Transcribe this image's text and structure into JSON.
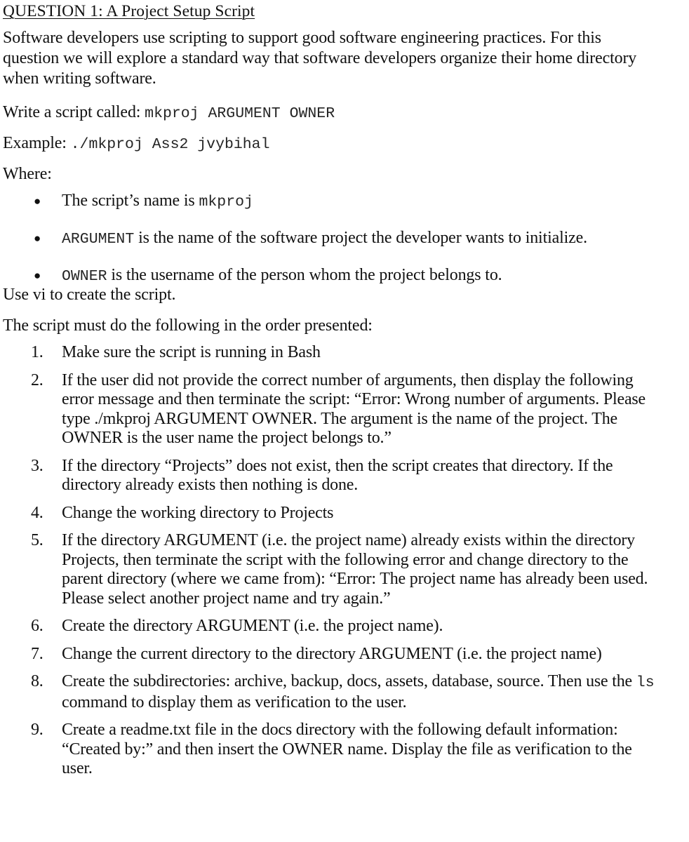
{
  "document": {
    "heading": "QUESTION 1: A Project Setup Script",
    "intro_paragraph": "Software developers use scripting to support good software engineering practices. For this question we will explore a standard way that software developers organize their home directory when writing software.",
    "script_call_label": "Write a script called:",
    "script_call_code": "mkproj ARGUMENT OWNER",
    "example_label": "Example:",
    "example_code": "./mkproj Ass2 jvybihal",
    "where_label": "Where:",
    "bullets": [
      {
        "prefix_text": "The script’s name is ",
        "prefix_mono": "",
        "code": "mkproj",
        "suffix": ""
      },
      {
        "prefix_text": "",
        "prefix_mono": "ARGUMENT",
        "code": "",
        "suffix": "  is the name of the software project the developer wants to initialize."
      },
      {
        "prefix_text": "",
        "prefix_mono": "OWNER",
        "code": "",
        "suffix": " is the username of the person whom the project belongs to."
      }
    ],
    "use_vi_line": "Use vi to create the script.",
    "order_line": "The script must do the following in the order presented:",
    "steps": [
      {
        "number": "1.",
        "text": "Make sure the script is running in Bash",
        "mono_fragment": "",
        "text_after_mono": ""
      },
      {
        "number": "2.",
        "text": "If the user did not provide the correct number of arguments, then display the following error message and then terminate the script: “Error: Wrong number of arguments. Please type ./mkproj ARGUMENT OWNER.  The argument is the name of the project. The OWNER is the user name the project belongs to.”",
        "mono_fragment": "",
        "text_after_mono": ""
      },
      {
        "number": "3.",
        "text": "If the directory “Projects” does not exist, then the script creates that directory. If the directory already exists then nothing is done.",
        "mono_fragment": "",
        "text_after_mono": ""
      },
      {
        "number": "4.",
        "text": "Change the working directory to Projects",
        "mono_fragment": "",
        "text_after_mono": ""
      },
      {
        "number": "5.",
        "text": "If the directory ARGUMENT (i.e. the project name) already exists within the directory Projects, then terminate the script with the following error and change directory to the parent directory (where we came from): “Error: The project name has already been used. Please select another project name and try again.”",
        "mono_fragment": "",
        "text_after_mono": ""
      },
      {
        "number": "6.",
        "text": "Create the directory ARGUMENT (i.e. the project name).",
        "mono_fragment": "",
        "text_after_mono": ""
      },
      {
        "number": "7.",
        "text": "Change the current directory to the directory ARGUMENT (i.e. the project name)",
        "mono_fragment": "",
        "text_after_mono": ""
      },
      {
        "number": "8.",
        "text": "Create the subdirectories: archive, backup, docs, assets, database, source. Then use the ",
        "mono_fragment": "ls",
        "text_after_mono": " command to display them as verification to the user."
      },
      {
        "number": "9.",
        "text": "Create a readme.txt file in the docs directory with the following default information: “Created by:” and then insert the OWNER name. Display the file as verification to the user.",
        "mono_fragment": "",
        "text_after_mono": ""
      }
    ]
  }
}
